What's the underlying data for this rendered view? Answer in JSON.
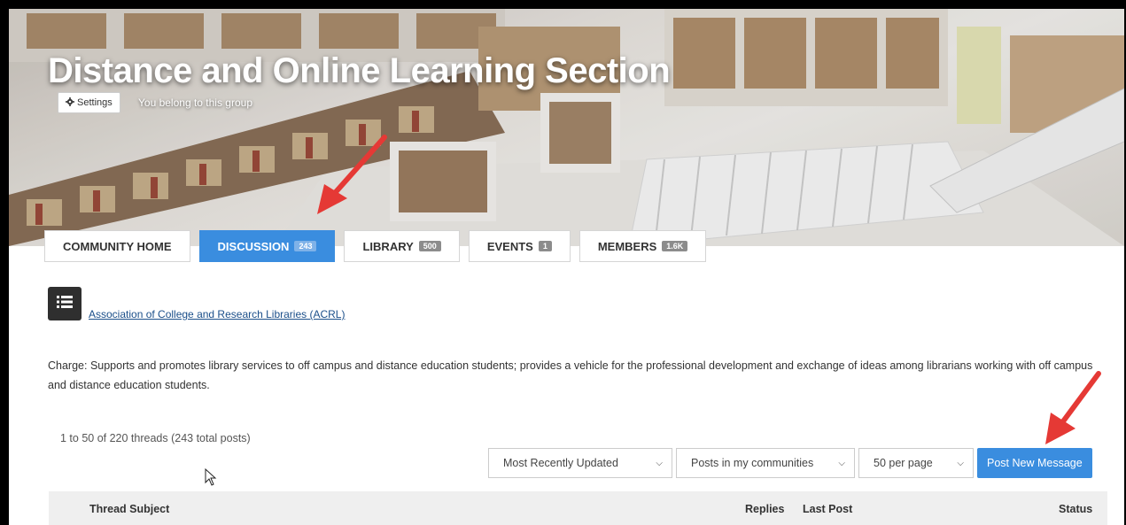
{
  "header": {
    "title": "Distance and Online Learning Section",
    "settings_label": "Settings",
    "membership_text": "You belong to this group"
  },
  "tabs": [
    {
      "label": "COMMUNITY HOME",
      "badge": ""
    },
    {
      "label": "DISCUSSION",
      "badge": "243"
    },
    {
      "label": "LIBRARY",
      "badge": "500"
    },
    {
      "label": "EVENTS",
      "badge": "1"
    },
    {
      "label": "MEMBERS",
      "badge": "1.6K"
    }
  ],
  "org_link": "Association of College and Research Libraries (ACRL)",
  "charge_text": "Charge: Supports and promotes library services to off campus and distance education students; provides a vehicle for the professional development and exchange of ideas among librarians working with off campus and distance education students.",
  "threads": {
    "count_text": "1 to 50 of 220 threads (243 total posts)",
    "sort_select": "Most Recently Updated",
    "filter_select": "Posts in my communities",
    "per_page_select": "50 per page",
    "post_button": "Post New Message"
  },
  "table": {
    "col_subject": "Thread Subject",
    "col_replies": "Replies",
    "col_last_post": "Last Post",
    "col_status": "Status"
  },
  "icons": {
    "settings": "gear-icon",
    "menu": "list-icon",
    "select_chevron": "chevron-down-icon"
  },
  "colors": {
    "accent": "#3a8ddf",
    "annotation_arrow": "#e53935"
  }
}
